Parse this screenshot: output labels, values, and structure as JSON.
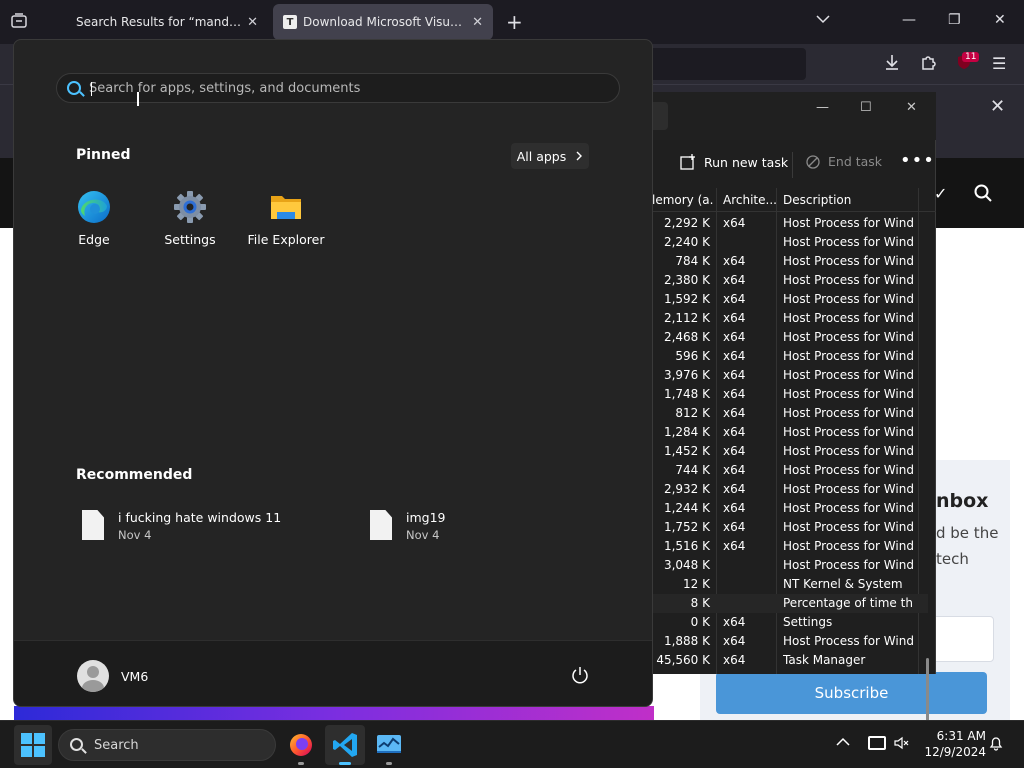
{
  "browser": {
    "tabs": [
      {
        "title": "Search Results for “mandrake” –"
      },
      {
        "title": "Download Microsoft Visual C+ –",
        "favicon": "T"
      }
    ],
    "extension_badge": "11"
  },
  "website": {
    "newsletter_title": "nbox",
    "newsletter_line1": "d be the",
    "newsletter_line2": "tech",
    "subscribe_label": "Subscribe"
  },
  "task_manager": {
    "run_new_task": "Run new task",
    "end_task": "End task",
    "columns": {
      "memory": "lemory (a...",
      "architecture": "Archite...",
      "description": "Description"
    },
    "rows": [
      {
        "mem": "2,292 K",
        "arch": "x64",
        "desc": "Host Process for Wind..."
      },
      {
        "mem": "2,240 K",
        "arch": "",
        "desc": "Host Process for Wind..."
      },
      {
        "mem": "784 K",
        "arch": "x64",
        "desc": "Host Process for Wind..."
      },
      {
        "mem": "2,380 K",
        "arch": "x64",
        "desc": "Host Process for Wind..."
      },
      {
        "mem": "1,592 K",
        "arch": "x64",
        "desc": "Host Process for Wind..."
      },
      {
        "mem": "2,112 K",
        "arch": "x64",
        "desc": "Host Process for Wind..."
      },
      {
        "mem": "2,468 K",
        "arch": "x64",
        "desc": "Host Process for Wind..."
      },
      {
        "mem": "596 K",
        "arch": "x64",
        "desc": "Host Process for Wind..."
      },
      {
        "mem": "3,976 K",
        "arch": "x64",
        "desc": "Host Process for Wind..."
      },
      {
        "mem": "1,748 K",
        "arch": "x64",
        "desc": "Host Process for Wind..."
      },
      {
        "mem": "812 K",
        "arch": "x64",
        "desc": "Host Process for Wind..."
      },
      {
        "mem": "1,284 K",
        "arch": "x64",
        "desc": "Host Process for Wind..."
      },
      {
        "mem": "1,452 K",
        "arch": "x64",
        "desc": "Host Process for Wind..."
      },
      {
        "mem": "744 K",
        "arch": "x64",
        "desc": "Host Process for Wind..."
      },
      {
        "mem": "2,932 K",
        "arch": "x64",
        "desc": "Host Process for Wind..."
      },
      {
        "mem": "1,244 K",
        "arch": "x64",
        "desc": "Host Process for Wind..."
      },
      {
        "mem": "1,752 K",
        "arch": "x64",
        "desc": "Host Process for Wind..."
      },
      {
        "mem": "1,516 K",
        "arch": "x64",
        "desc": "Host Process for Wind..."
      },
      {
        "mem": "3,048 K",
        "arch": "",
        "desc": "Host Process for Wind..."
      },
      {
        "mem": "12 K",
        "arch": "",
        "desc": "NT Kernel & System"
      },
      {
        "mem": "8 K",
        "arch": "",
        "desc": "Percentage of time th..."
      },
      {
        "mem": "0 K",
        "arch": "x64",
        "desc": "Settings"
      },
      {
        "mem": "1,888 K",
        "arch": "x64",
        "desc": "Host Process for Wind..."
      },
      {
        "mem": "45,560 K",
        "arch": "x64",
        "desc": "Task Manager"
      }
    ]
  },
  "start_menu": {
    "search_placeholder": "Search for apps, settings, and documents",
    "pinned_title": "Pinned",
    "all_apps_label": "All apps",
    "pinned": [
      {
        "label": "Edge",
        "icon": "edge-icon"
      },
      {
        "label": "Settings",
        "icon": "gear-icon"
      },
      {
        "label": "File Explorer",
        "icon": "folder-icon"
      }
    ],
    "recommended_title": "Recommended",
    "recommended": [
      {
        "name": "i fucking hate windows 11",
        "date": "Nov 4"
      },
      {
        "name": "img19",
        "date": "Nov 4"
      }
    ],
    "user_name": "VM6"
  },
  "taskbar": {
    "search_label": "Search",
    "time": "6:31 AM",
    "date": "12/9/2024"
  },
  "colors": {
    "accent": "#4cc2ff",
    "start_bg": "#242424",
    "taskbar_bg": "#1c1c1c"
  }
}
